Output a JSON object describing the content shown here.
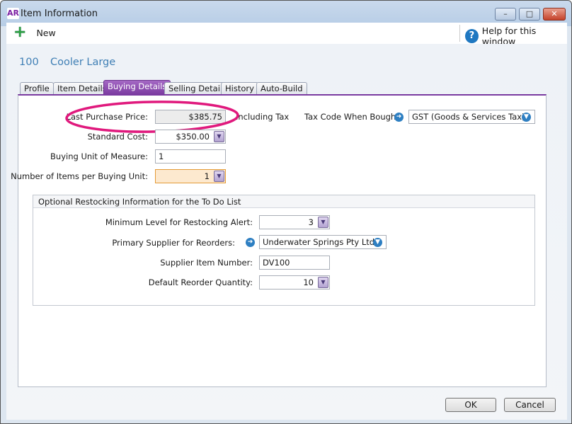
{
  "window": {
    "title": "Item Information",
    "logo": "AR",
    "minimize": "–",
    "maximize": "□",
    "close": "✕"
  },
  "toolbar": {
    "new_label": "New",
    "help_label": "Help for this window"
  },
  "item": {
    "number": "100",
    "name": "Cooler Large"
  },
  "tabs": [
    {
      "label": "Profile"
    },
    {
      "label": "Item Details"
    },
    {
      "label": "Buying Details",
      "active": true
    },
    {
      "label": "Selling Details"
    },
    {
      "label": "History"
    },
    {
      "label": "Auto-Build"
    }
  ],
  "form": {
    "last_purchase_price": {
      "label": "Last Purchase Price:",
      "value": "$385.75",
      "suffix": "Including Tax"
    },
    "standard_cost": {
      "label": "Standard Cost:",
      "value": "$350.00"
    },
    "buying_unit": {
      "label": "Buying Unit of Measure:",
      "value": "1"
    },
    "items_per_unit": {
      "label": "Number of Items per Buying Unit:",
      "value": "1"
    },
    "tax_code": {
      "label": "Tax Code When Bought",
      "value": "GST (Goods & Services Tax)"
    }
  },
  "restock": {
    "title": "Optional Restocking Information for the To Do List",
    "min_level": {
      "label": "Minimum Level for Restocking Alert:",
      "value": "3"
    },
    "supplier": {
      "label": "Primary Supplier for Reorders:",
      "value": "Underwater Springs Pty Ltd"
    },
    "supplier_item": {
      "label": "Supplier Item Number:",
      "value": "DV100"
    },
    "reorder_qty": {
      "label": "Default Reorder Quantity:",
      "value": "10"
    }
  },
  "buttons": {
    "ok": "OK",
    "cancel": "Cancel"
  },
  "colors": {
    "accent": "#7a3aa0",
    "highlight_ellipse": "#e0197d",
    "item_header": "#3f7fb5"
  }
}
